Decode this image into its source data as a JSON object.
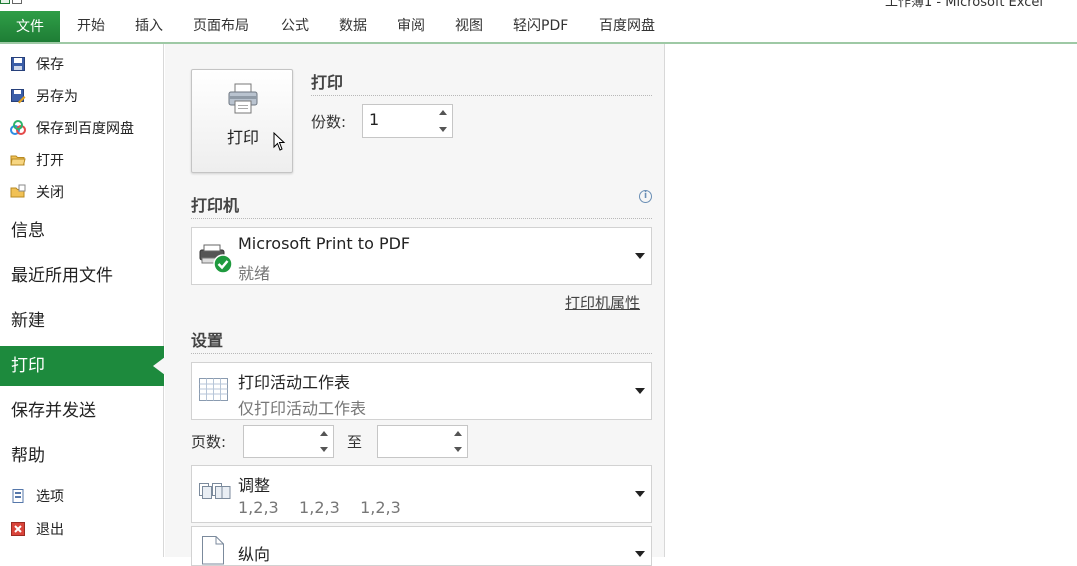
{
  "window": {
    "title": "工作簿1 - Microsoft Excel"
  },
  "ribbon": {
    "file_tab": "文件",
    "tabs": [
      "开始",
      "插入",
      "页面布局",
      "公式",
      "数据",
      "审阅",
      "视图",
      "轻闪PDF",
      "百度网盘"
    ]
  },
  "nav": {
    "save": "保存",
    "save_as": "另存为",
    "save_to_baidu": "保存到百度网盘",
    "open": "打开",
    "close": "关闭",
    "info": "信息",
    "recent": "最近所用文件",
    "new": "新建",
    "print": "打印",
    "save_send": "保存并发送",
    "help": "帮助",
    "options": "选项",
    "exit": "退出"
  },
  "print": {
    "button_label": "打印",
    "section_title": "打印",
    "copies_label": "份数:",
    "copies_value": "1"
  },
  "printer": {
    "section_title": "打印机",
    "name": "Microsoft Print to PDF",
    "status": "就绪",
    "properties_link": "打印机属性"
  },
  "settings": {
    "section_title": "设置",
    "scope_main": "打印活动工作表",
    "scope_sub": "仅打印活动工作表",
    "pages_label": "页数:",
    "pages_from": "",
    "to_label": "至",
    "pages_to": "",
    "collate_main": "调整",
    "collate_sub": "1,2,3    1,2,3    1,2,3",
    "orientation_main": "纵向"
  },
  "colors": {
    "accent": "#1d8a3d",
    "panel_bg": "#f6f6f6"
  }
}
